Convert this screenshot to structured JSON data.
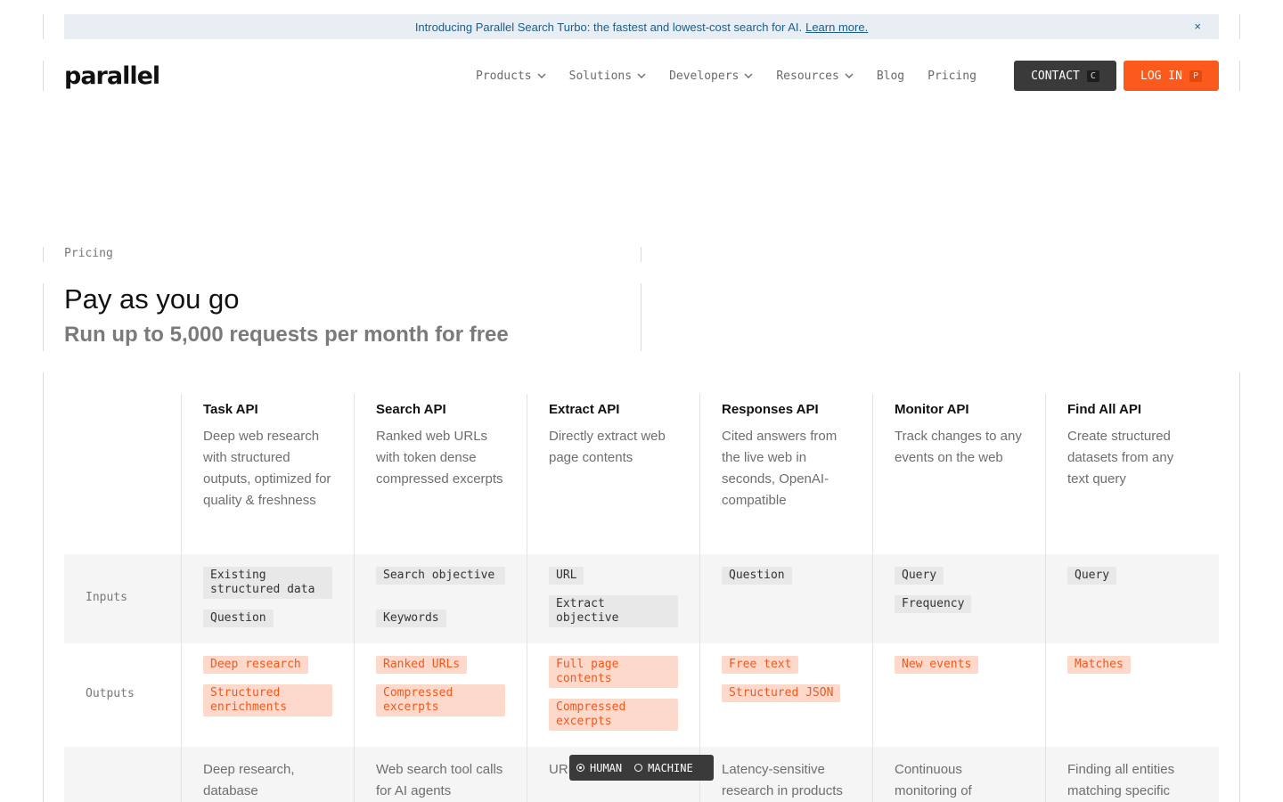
{
  "banner": {
    "text": "Introducing Parallel Search Turbo: the fastest and lowest-cost search for AI.",
    "link": "Learn more.",
    "close": "×"
  },
  "header": {
    "logo": "parallel",
    "nav": [
      {
        "label": "Products",
        "dropdown": true
      },
      {
        "label": "Solutions",
        "dropdown": true
      },
      {
        "label": "Developers",
        "dropdown": true
      },
      {
        "label": "Resources",
        "dropdown": true
      },
      {
        "label": "Blog",
        "dropdown": false
      },
      {
        "label": "Pricing",
        "dropdown": false
      }
    ],
    "contact": {
      "label": "CONTACT",
      "key": "C"
    },
    "login": {
      "label": "LOG IN",
      "key": "P"
    }
  },
  "pricing": {
    "eyebrow": "Pricing",
    "title": "Pay as you go",
    "subtitle": "Run up to 5,000 requests per month for free"
  },
  "table": {
    "row_labels": {
      "inputs": "Inputs",
      "outputs": "Outputs"
    },
    "apis": [
      {
        "name": "Task API",
        "desc": "Deep web research with structured outputs, optimized for quality & freshness",
        "inputs": [
          "Existing structured data",
          "Question"
        ],
        "outputs": [
          "Deep research",
          "Structured enrichments"
        ],
        "usecase": "Deep research, database"
      },
      {
        "name": "Search API",
        "desc": "Ranked web URLs with token dense compressed excerpts",
        "inputs": [
          "Search objective",
          "Keywords"
        ],
        "outputs": [
          "Ranked URLs",
          "Compressed excerpts"
        ],
        "usecase": "Web search tool calls for AI agents"
      },
      {
        "name": "Extract API",
        "desc": "Directly extract web page contents",
        "inputs": [
          "URL",
          "Extract objective"
        ],
        "outputs": [
          "Full page contents",
          "Compressed excerpts"
        ],
        "usecase": "URL extraction"
      },
      {
        "name": "Responses API",
        "desc": "Cited answers from the live web in seconds, OpenAI-compatible",
        "inputs": [
          "Question"
        ],
        "outputs": [
          "Free text",
          "Structured JSON"
        ],
        "usecase": "Latency-sensitive research in products"
      },
      {
        "name": "Monitor API",
        "desc": "Track changes to any events on the web",
        "inputs": [
          "Query",
          "Frequency"
        ],
        "outputs": [
          "New events"
        ],
        "usecase": "Continuous monitoring of"
      },
      {
        "name": "Find All API",
        "desc": "Create structured datasets from any text query",
        "inputs": [
          "Query"
        ],
        "outputs": [
          "Matches"
        ],
        "usecase": "Finding all entities matching specific"
      }
    ]
  },
  "toggle": {
    "human": "HUMAN",
    "machine": "MACHINE",
    "selected": "HUMAN"
  }
}
